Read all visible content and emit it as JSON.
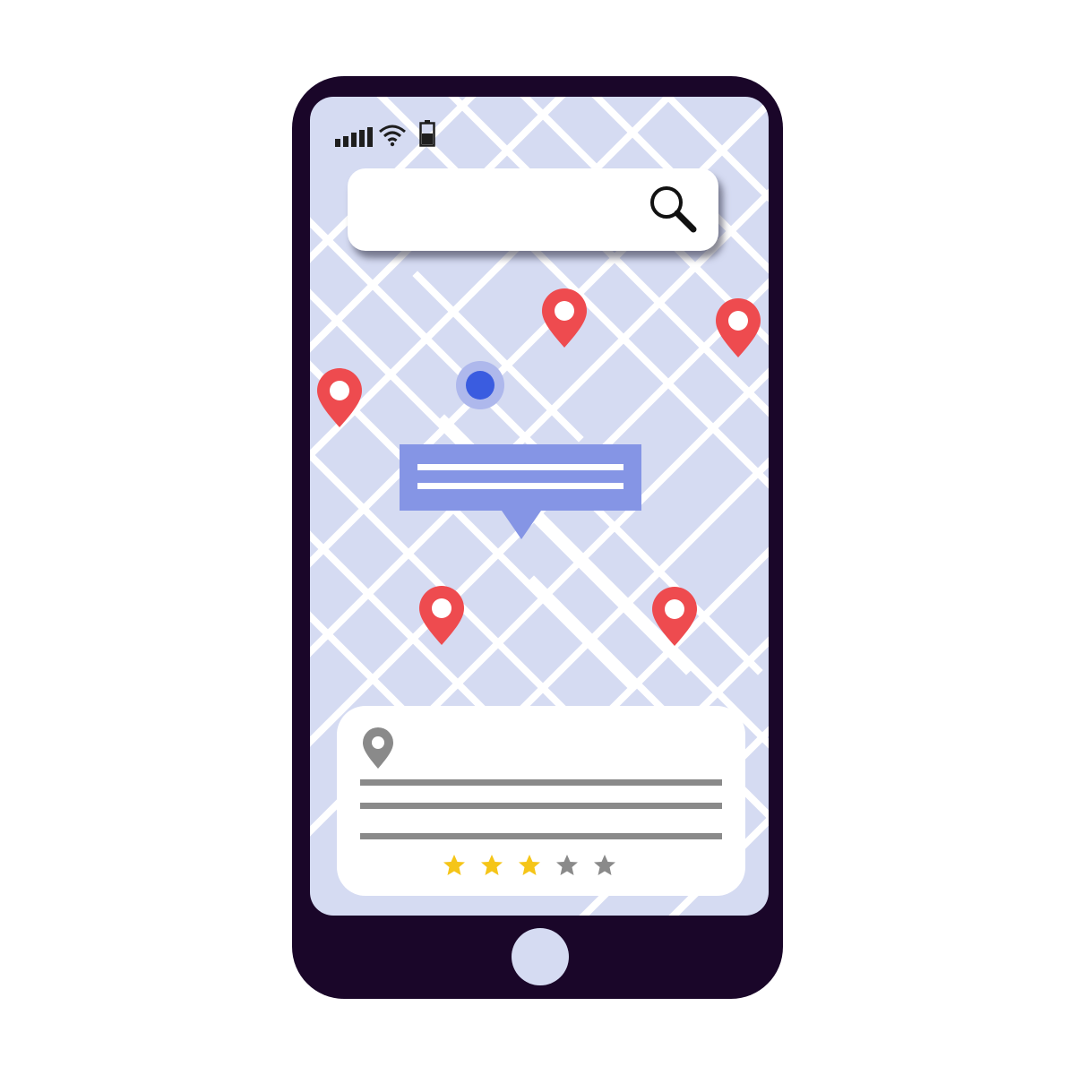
{
  "status_bar": {
    "signal_icon": "signal-bars-icon",
    "wifi_icon": "wifi-icon",
    "battery_icon": "battery-low-icon"
  },
  "search": {
    "value": "",
    "placeholder": "",
    "icon": "magnifier-icon"
  },
  "map": {
    "background_color": "#d5dbf2",
    "street_color": "#ffffff",
    "current_location_icon": "current-location-dot-icon",
    "pin_icon": "map-pin-icon",
    "pin_color": "#ee4b4f",
    "pin_count": 5
  },
  "callout": {
    "color": "#8595e5"
  },
  "place_card": {
    "icon": "location-pin-icon",
    "rating": 3,
    "rating_max": 5,
    "star_filled_color": "#f5c518",
    "star_empty_color": "#8a8a8a"
  },
  "device": {
    "frame_color": "#1a0629",
    "home_button_icon": "home-button-icon"
  }
}
